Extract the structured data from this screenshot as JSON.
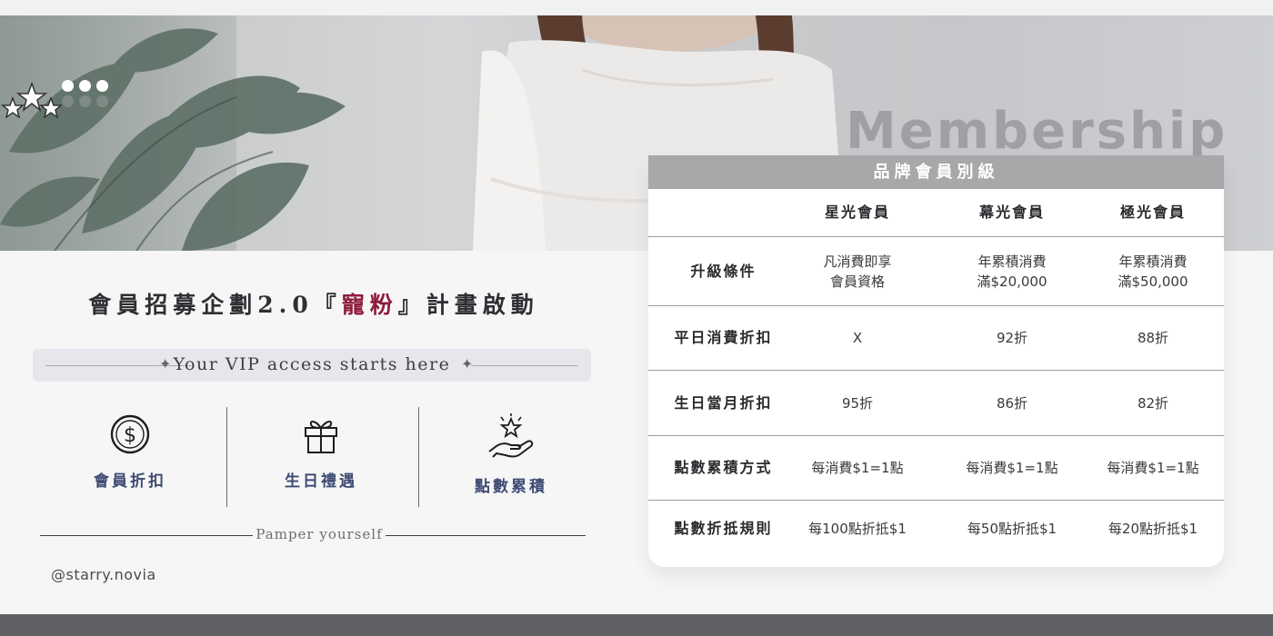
{
  "hero": {
    "brand_word": "Membership"
  },
  "left": {
    "headline_prefix": "會員招募企劃2.0『",
    "headline_highlight": "寵粉",
    "headline_suffix": "』計畫啟動",
    "vip_tagline": "Your VIP access starts here",
    "features": [
      {
        "label": "會員折扣",
        "icon": "dollar-coin-icon"
      },
      {
        "label": "生日禮遇",
        "icon": "gift-box-icon"
      },
      {
        "label": "點數累積",
        "icon": "hand-star-icon"
      }
    ],
    "pamper": "Pamper yourself",
    "handle": "@starry.novia"
  },
  "table": {
    "title": "品牌會員別級",
    "columns": [
      "",
      "星光會員",
      "幕光會員",
      "極光會員"
    ],
    "rows": [
      {
        "label": "升級條件",
        "cells": [
          "凡消費即享\n會員資格",
          "年累積消費\n滿$20,000",
          "年累積消費\n滿$50,000"
        ]
      },
      {
        "label": "平日消費折扣",
        "cells": [
          "X",
          "92折",
          "88折"
        ]
      },
      {
        "label": "生日當月折扣",
        "cells": [
          "95折",
          "86折",
          "82折"
        ]
      },
      {
        "label": "點數累積方式",
        "cells": [
          "每消費$1=1點",
          "每消費$1=1點",
          "每消費$1=1點"
        ]
      },
      {
        "label": "點數折抵規則",
        "cells": [
          "每100點折抵$1",
          "每50點折抵$1",
          "每20點折抵$1"
        ]
      }
    ]
  },
  "colors": {
    "accent": "#8e1c3c",
    "feature_text": "#3d4a72",
    "table_header": "#a7a8aa",
    "footer_bar": "#606164"
  }
}
